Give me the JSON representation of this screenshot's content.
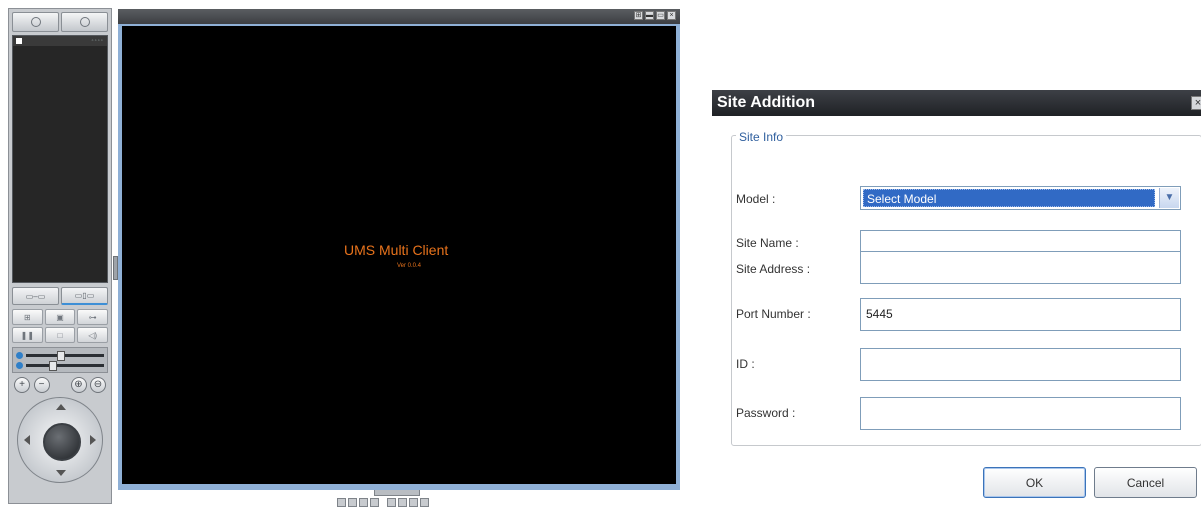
{
  "viewer": {
    "brand": "UMS Multi Client",
    "version": "Ver 0.0.4"
  },
  "dialog": {
    "title": "Site Addition",
    "group_legend": "Site Info",
    "fields": [
      {
        "label": "Model :",
        "value": "Select Model",
        "type": "select"
      },
      {
        "label": "Site Name :",
        "value": ""
      },
      {
        "label": "Site Address :",
        "value": ""
      },
      {
        "label": "Port Number :",
        "value": "5445"
      },
      {
        "label": "ID :",
        "value": ""
      },
      {
        "label": "Password :",
        "value": ""
      }
    ],
    "ok_label": "OK",
    "cancel_label": "Cancel"
  },
  "colors": {
    "brand_orange": "#e8731c",
    "selection_blue": "#316ac5",
    "viewer_frame": "#8fb0d6"
  }
}
